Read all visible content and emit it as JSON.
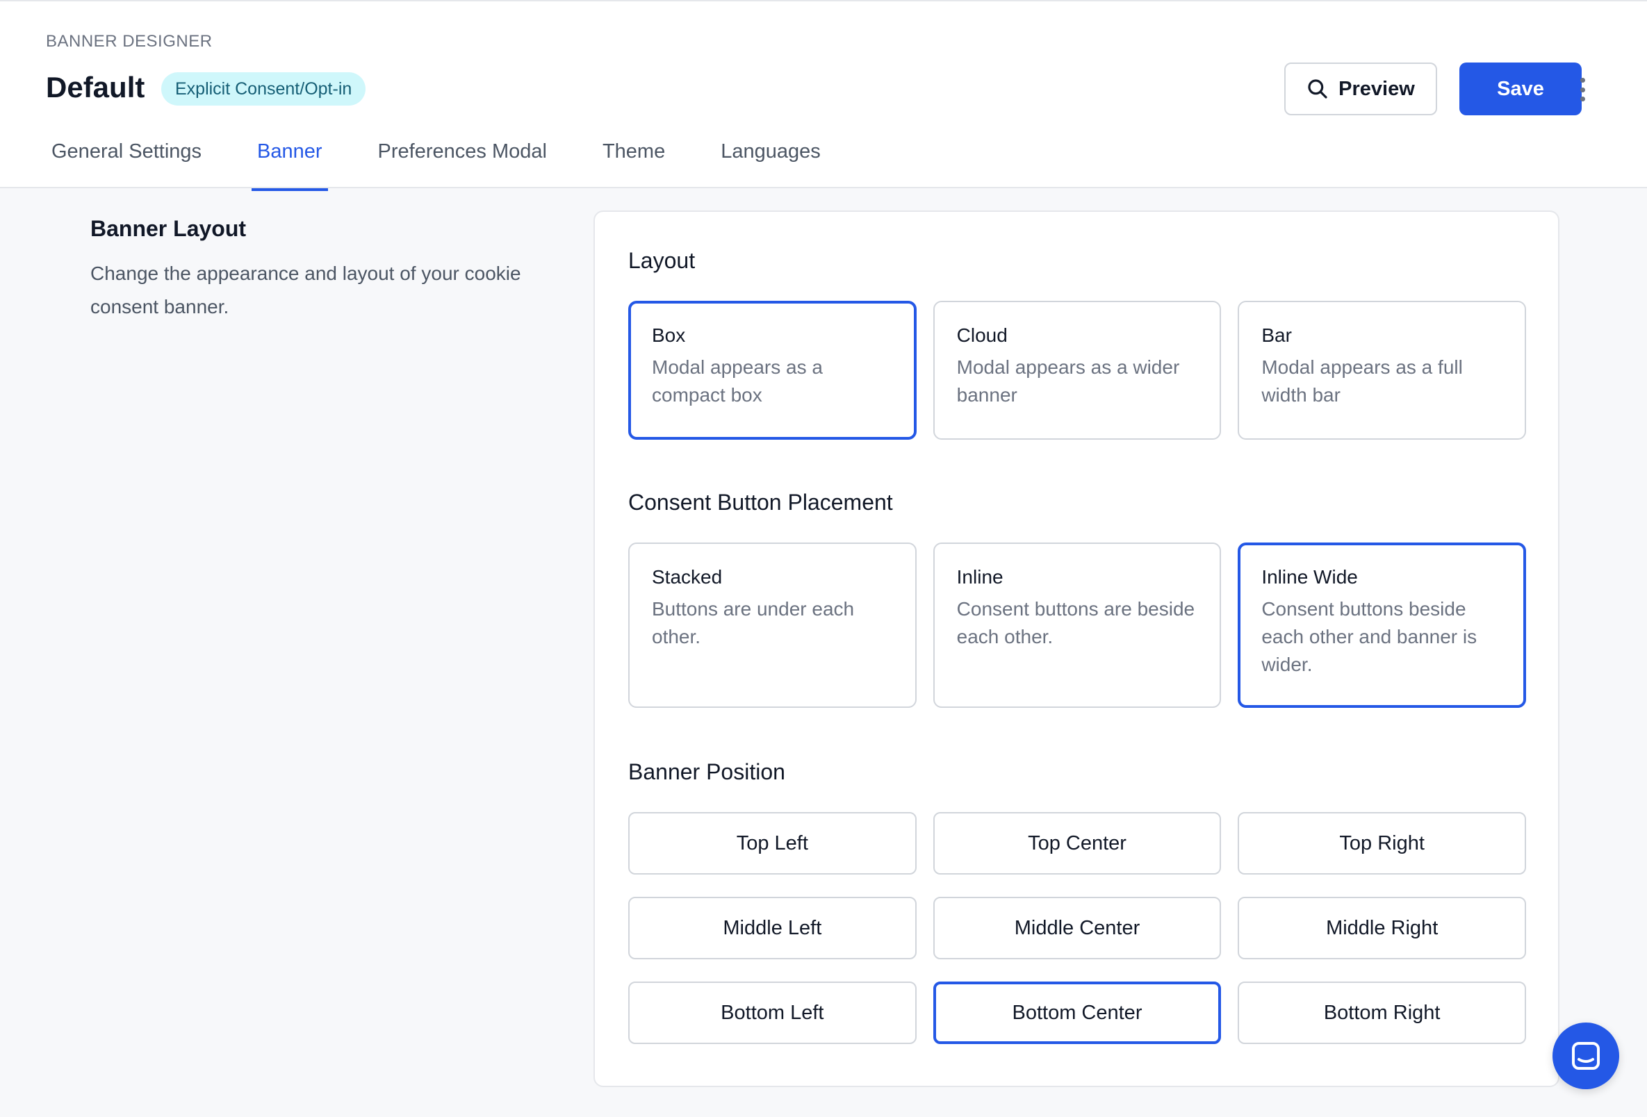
{
  "header": {
    "eyebrow": "BANNER DESIGNER",
    "title": "Default",
    "badge": "Explicit Consent/Opt-in",
    "preview_label": "Preview",
    "save_label": "Save"
  },
  "tabs": [
    {
      "label": "General Settings",
      "active": false
    },
    {
      "label": "Banner",
      "active": true
    },
    {
      "label": "Preferences Modal",
      "active": false
    },
    {
      "label": "Theme",
      "active": false
    },
    {
      "label": "Languages",
      "active": false
    }
  ],
  "intro": {
    "title": "Banner Layout",
    "description": "Change the appearance and layout of your cookie consent banner."
  },
  "layout": {
    "title": "Layout",
    "options": [
      {
        "title": "Box",
        "description": "Modal appears as a compact box",
        "selected": true
      },
      {
        "title": "Cloud",
        "description": "Modal appears as a wider banner",
        "selected": false
      },
      {
        "title": "Bar",
        "description": "Modal appears as a full width bar",
        "selected": false
      }
    ]
  },
  "placement": {
    "title": "Consent Button Placement",
    "options": [
      {
        "title": "Stacked",
        "description": "Buttons are under each other.",
        "selected": false
      },
      {
        "title": "Inline",
        "description": "Consent buttons are beside each other.",
        "selected": false
      },
      {
        "title": "Inline Wide",
        "description": "Consent buttons beside each other and banner is wider.",
        "selected": true
      }
    ]
  },
  "position": {
    "title": "Banner Position",
    "options": [
      {
        "label": "Top Left",
        "selected": false
      },
      {
        "label": "Top Center",
        "selected": false
      },
      {
        "label": "Top Right",
        "selected": false
      },
      {
        "label": "Middle Left",
        "selected": false
      },
      {
        "label": "Middle Center",
        "selected": false
      },
      {
        "label": "Middle Right",
        "selected": false
      },
      {
        "label": "Bottom Left",
        "selected": false
      },
      {
        "label": "Bottom Center",
        "selected": true
      },
      {
        "label": "Bottom Right",
        "selected": false
      }
    ]
  },
  "colors": {
    "accent": "#2458e6",
    "badge_bg": "#cff7fb",
    "badge_text": "#155e75"
  },
  "icons": {
    "preview": "search-icon",
    "more": "kebab-menu-icon",
    "chat": "chat-icon"
  }
}
